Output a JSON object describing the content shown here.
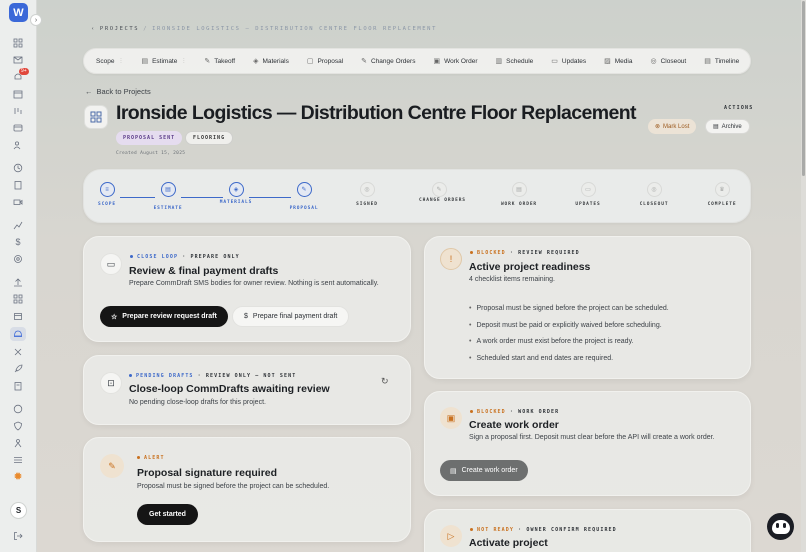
{
  "app": {
    "logo_letter": "W",
    "avatar_initial": "S",
    "notification_badge": "9+"
  },
  "sidebar": {
    "icons": [
      "grid-icon",
      "mail-icon",
      "bell-icon",
      "calendar-icon",
      "flow-icon",
      "card-icon",
      "users-icon",
      "clock-icon",
      "clipboard-icon",
      "video-icon",
      "chart-icon",
      "dollar-icon",
      "settings-icon",
      "upload-icon",
      "grid-icon-2",
      "box-icon",
      "helmet-icon",
      "tools-icon",
      "rocket-icon",
      "file-icon",
      "palette-icon",
      "shield-icon",
      "user-tree-icon",
      "list-icon",
      "sun-icon"
    ]
  },
  "breadcrumb": {
    "root": "PROJECTS",
    "current": "IRONSIDE LOGISTICS — DISTRIBUTION CENTRE FLOOR REPLACEMENT"
  },
  "tabs": [
    {
      "label": "Scope",
      "chevron": true
    },
    {
      "label": "Estimate",
      "chevron": true
    },
    {
      "label": "Takeoff"
    },
    {
      "label": "Materials"
    },
    {
      "label": "Proposal"
    },
    {
      "label": "Change Orders"
    },
    {
      "label": "Work Order"
    },
    {
      "label": "Schedule"
    },
    {
      "label": "Updates"
    },
    {
      "label": "Media"
    },
    {
      "label": "Closeout"
    },
    {
      "label": "Timeline"
    }
  ],
  "back_link": "Back to Projects",
  "project": {
    "title": "Ironside Logistics — Distribution Centre Floor Replacement",
    "status": "PROPOSAL SENT",
    "type": "FLOORING",
    "created": "Created August 15, 2025"
  },
  "actions": {
    "label": "ACTIONS",
    "mark_lost": "Mark Lost",
    "archive": "Archive"
  },
  "steps": [
    {
      "label": "SCOPE",
      "done": true
    },
    {
      "label": "ESTIMATE",
      "done": true
    },
    {
      "label": "MATERIALS",
      "done": true
    },
    {
      "label": "PROPOSAL",
      "done": true
    },
    {
      "label": "SIGNED",
      "done": false
    },
    {
      "label": "CHANGE ORDERS",
      "done": false
    },
    {
      "label": "WORK ORDER",
      "done": false
    },
    {
      "label": "UPDATES",
      "done": false
    },
    {
      "label": "CLOSEOUT",
      "done": false
    },
    {
      "label": "COMPLETE",
      "done": false
    }
  ],
  "cards": {
    "close_loop": {
      "eyebrow": "CLOSE LOOP",
      "eyebrow_sub": "· PREPARE ONLY",
      "title": "Review & final payment drafts",
      "desc": "Prepare CommDraft SMS bodies for owner review. Nothing is sent automatically.",
      "btn_primary": "Prepare review request draft",
      "btn_secondary": "Prepare final payment draft"
    },
    "pending": {
      "eyebrow": "PENDING DRAFTS",
      "eyebrow_sub": "· REVIEW ONLY — NOT SENT",
      "title": "Close-loop CommDrafts awaiting review",
      "desc": "No pending close-loop drafts for this project."
    },
    "alert": {
      "eyebrow": "ALERT",
      "title": "Proposal signature required",
      "desc": "Proposal must be signed before the project can be scheduled.",
      "btn": "Get started"
    },
    "readiness": {
      "eyebrow": "BLOCKED",
      "eyebrow_sub": "· REVIEW REQUIRED",
      "title": "Active project readiness",
      "desc": "4 checklist items remaining.",
      "items": [
        "Proposal must be signed before the project can be scheduled.",
        "Deposit must be paid or explicitly waived before scheduling.",
        "A work order must exist before the project is ready.",
        "Scheduled start and end dates are required."
      ]
    },
    "work_order": {
      "eyebrow": "BLOCKED",
      "eyebrow_sub": "· WORK ORDER",
      "title": "Create work order",
      "desc": "Sign a proposal first. Deposit must clear before the API will create a work order.",
      "btn": "Create work order"
    },
    "activate": {
      "eyebrow": "NOT READY",
      "eyebrow_sub": "· OWNER CONFIRM REQUIRED",
      "title": "Activate project"
    }
  },
  "colors": {
    "accent": "#3d69c9",
    "orange": "#c9711f",
    "alert_red": "#e0473c"
  }
}
